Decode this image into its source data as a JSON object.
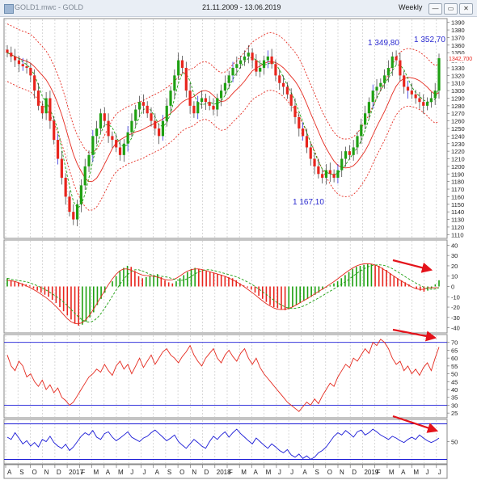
{
  "window": {
    "title_left": "GOLD1.mwc - GOLD",
    "title_mid": "21.11.2009 - 13.06.2019",
    "period": "Weekly",
    "btn_min": "—",
    "btn_restore": "▭",
    "btn_close": "✕"
  },
  "colors": {
    "up_candle": "#1fa012",
    "down_candle": "#e8251d",
    "neutral_candle": "#1515d6",
    "band_line": "#e52a1f",
    "signal_line": "#1fa012",
    "rsi_line": "#e52a1f",
    "stoch_line": "#1a1ad6",
    "arrow": "#e4121a",
    "label_blue": "#2a2ad0"
  },
  "x_axis": {
    "labels": [
      "A",
      "S",
      "O",
      "N",
      "D",
      "2017",
      "F",
      "M",
      "A",
      "M",
      "J",
      "J",
      "A",
      "S",
      "O",
      "N",
      "D",
      "2018",
      "F",
      "M",
      "A",
      "M",
      "J",
      "J",
      "A",
      "S",
      "O",
      "N",
      "D",
      "2019",
      "F",
      "M",
      "A",
      "M",
      "J",
      "J"
    ]
  },
  "chart_data": [
    {
      "type": "candlestick",
      "panel": "price",
      "ylim": [
        1105,
        1395
      ],
      "yticks": [
        1110,
        1120,
        1130,
        1140,
        1150,
        1160,
        1170,
        1180,
        1190,
        1200,
        1210,
        1220,
        1230,
        1240,
        1250,
        1260,
        1270,
        1280,
        1290,
        1300,
        1310,
        1320,
        1330,
        1340,
        1350,
        1360,
        1370,
        1380,
        1390
      ],
      "last_price_label": "1342,700",
      "annotations": [
        {
          "text": "1 349,80",
          "value": 1349.8
        },
        {
          "text": "1 352,70",
          "value": 1352.7
        },
        {
          "text": "1 167,10",
          "value": 1167.1
        }
      ],
      "close_path": [
        1350,
        1345,
        1340,
        1335,
        1332,
        1330,
        1320,
        1300,
        1280,
        1270,
        1290,
        1260,
        1235,
        1210,
        1185,
        1160,
        1140,
        1130,
        1150,
        1175,
        1200,
        1215,
        1240,
        1250,
        1270,
        1260,
        1240,
        1235,
        1225,
        1215,
        1230,
        1245,
        1260,
        1275,
        1285,
        1280,
        1270,
        1260,
        1250,
        1240,
        1260,
        1280,
        1300,
        1320,
        1340,
        1330,
        1300,
        1280,
        1270,
        1285,
        1290,
        1285,
        1280,
        1275,
        1290,
        1300,
        1310,
        1320,
        1330,
        1335,
        1340,
        1345,
        1350,
        1340,
        1325,
        1330,
        1340,
        1345,
        1335,
        1320,
        1310,
        1305,
        1295,
        1280,
        1265,
        1250,
        1240,
        1225,
        1210,
        1200,
        1190,
        1185,
        1195,
        1190,
        1185,
        1195,
        1210,
        1220,
        1215,
        1225,
        1240,
        1255,
        1270,
        1285,
        1300,
        1305,
        1310,
        1320,
        1330,
        1345,
        1340,
        1320,
        1305,
        1300,
        1295,
        1290,
        1285,
        1280,
        1285,
        1290,
        1300,
        1342.7
      ]
    },
    {
      "type": "histogram",
      "panel": "oscillator",
      "ylim": [
        -45,
        45
      ],
      "yticks": [
        -40,
        -30,
        -20,
        -10,
        0,
        10,
        20,
        30,
        40
      ],
      "values": [
        8,
        6,
        5,
        4,
        3,
        2,
        1,
        -2,
        -4,
        -6,
        -8,
        -10,
        -13,
        -16,
        -20,
        -24,
        -28,
        -32,
        -36,
        -38,
        -37,
        -34,
        -30,
        -25,
        -18,
        -12,
        -6,
        0,
        5,
        10,
        15,
        18,
        20,
        19,
        15,
        10,
        8,
        9,
        10,
        11,
        12,
        9,
        6,
        4,
        3,
        5,
        8,
        11,
        14,
        17,
        18,
        17,
        16,
        15,
        14,
        13,
        12,
        11,
        10,
        9,
        8,
        6,
        3,
        1,
        -1,
        -3,
        -6,
        -9,
        -12,
        -15,
        -18,
        -20,
        -21,
        -22,
        -23,
        -22,
        -20,
        -18,
        -16,
        -14,
        -12,
        -10,
        -8,
        -6,
        -3,
        -1,
        1,
        3,
        5,
        8,
        11,
        14,
        17,
        19,
        20,
        21,
        22,
        22,
        21,
        20,
        18,
        16,
        13,
        10,
        8,
        6,
        4,
        2,
        0,
        -2,
        -4,
        -5,
        -4,
        -2,
        2,
        6
      ]
    },
    {
      "type": "line",
      "panel": "rsi",
      "ylim": [
        22,
        75
      ],
      "yticks": [
        25,
        30,
        35,
        40,
        45,
        50,
        55,
        60,
        65,
        70
      ],
      "reference_lines": [
        30,
        70
      ],
      "values": [
        62,
        55,
        52,
        58,
        55,
        48,
        50,
        45,
        42,
        46,
        40,
        43,
        38,
        41,
        35,
        33,
        30,
        32,
        36,
        40,
        44,
        48,
        50,
        53,
        51,
        56,
        52,
        49,
        55,
        58,
        53,
        56,
        50,
        55,
        60,
        54,
        58,
        62,
        56,
        60,
        64,
        66,
        62,
        60,
        57,
        61,
        64,
        68,
        62,
        58,
        55,
        60,
        63,
        66,
        60,
        57,
        62,
        65,
        61,
        58,
        63,
        66,
        60,
        56,
        60,
        54,
        50,
        47,
        44,
        41,
        38,
        35,
        32,
        30,
        28,
        26,
        29,
        32,
        30,
        34,
        31,
        36,
        40,
        44,
        42,
        48,
        52,
        56,
        54,
        60,
        58,
        62,
        66,
        63,
        70,
        68,
        72,
        70,
        66,
        60,
        56,
        58,
        52,
        55,
        50,
        53,
        49,
        54,
        57,
        52,
        60,
        67
      ]
    },
    {
      "type": "line",
      "panel": "stochastic",
      "ylim": [
        0,
        100
      ],
      "yticks": [
        50
      ],
      "reference_lines": [
        10,
        90
      ],
      "values": [
        60,
        55,
        70,
        58,
        45,
        52,
        40,
        48,
        38,
        55,
        50,
        62,
        48,
        40,
        35,
        44,
        30,
        38,
        50,
        62,
        70,
        65,
        75,
        60,
        55,
        68,
        72,
        60,
        52,
        58,
        65,
        72,
        60,
        55,
        50,
        58,
        62,
        70,
        76,
        68,
        60,
        52,
        58,
        65,
        50,
        42,
        35,
        45,
        55,
        48,
        40,
        35,
        50,
        62,
        55,
        65,
        72,
        60,
        70,
        78,
        68,
        60,
        52,
        45,
        58,
        50,
        42,
        35,
        45,
        38,
        30,
        25,
        32,
        20,
        15,
        22,
        12,
        18,
        10,
        15,
        25,
        30,
        38,
        50,
        62,
        70,
        65,
        75,
        68,
        60,
        72,
        76,
        65,
        70,
        78,
        72,
        65,
        60,
        55,
        62,
        58,
        52,
        48,
        55,
        60,
        55,
        65,
        58,
        52,
        48,
        52,
        58
      ]
    }
  ]
}
